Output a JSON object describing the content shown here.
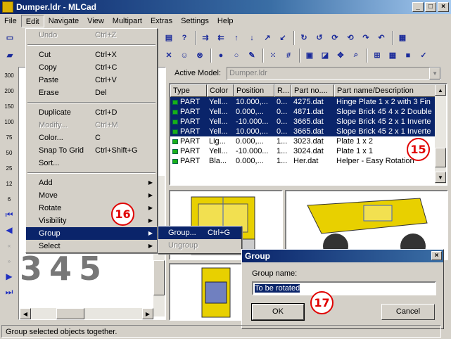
{
  "window": {
    "title": "Dumper.ldr - MLCad",
    "minimize": "_",
    "maximize": "□",
    "close": "×"
  },
  "menubar": [
    "File",
    "Edit",
    "Navigate",
    "View",
    "Multipart",
    "Extras",
    "Settings",
    "Help"
  ],
  "edit_menu": {
    "items": [
      {
        "label": "Undo",
        "shortcut": "Ctrl+Z",
        "disabled": true
      },
      {
        "sep": true
      },
      {
        "label": "Cut",
        "shortcut": "Ctrl+X"
      },
      {
        "label": "Copy",
        "shortcut": "Ctrl+C"
      },
      {
        "label": "Paste",
        "shortcut": "Ctrl+V"
      },
      {
        "label": "Erase",
        "shortcut": "Del"
      },
      {
        "sep": true
      },
      {
        "label": "Duplicate",
        "shortcut": "Ctrl+D"
      },
      {
        "label": "Modify...",
        "shortcut": "Ctrl+M",
        "disabled": true
      },
      {
        "label": "Color...",
        "shortcut": "C"
      },
      {
        "label": "Snap To Grid",
        "shortcut": "Ctrl+Shift+G"
      },
      {
        "label": "Sort..."
      },
      {
        "sep": true
      },
      {
        "label": "Add",
        "submenu": true
      },
      {
        "label": "Move",
        "submenu": true
      },
      {
        "label": "Rotate",
        "submenu": true
      },
      {
        "label": "Visibility",
        "submenu": true
      },
      {
        "label": "Group",
        "submenu": true,
        "highlighted": true
      },
      {
        "label": "Select",
        "submenu": true
      }
    ]
  },
  "group_submenu": [
    {
      "label": "Group...",
      "shortcut": "Ctrl+G",
      "highlighted": true
    },
    {
      "label": "Ungroup",
      "disabled": true
    }
  ],
  "active_model": {
    "label": "Active Model:",
    "value": "Dumper.ldr"
  },
  "parts_table": {
    "columns": [
      "Type",
      "Color",
      "Position",
      "R...",
      "Part no....",
      "Part name/Description"
    ],
    "rows": [
      {
        "type": "PART",
        "color": "Yell...",
        "position": "10.000,...",
        "r": "0...",
        "partno": "4275.dat",
        "desc": "Hinge Plate  1 x 2 with 3 Fin",
        "selected": true
      },
      {
        "type": "PART",
        "color": "Yell...",
        "position": "0.000,...",
        "r": "0...",
        "partno": "4871.dat",
        "desc": "Slope Brick 45  4 x 2 Double",
        "selected": true
      },
      {
        "type": "PART",
        "color": "Yell...",
        "position": "-10.000...",
        "r": "0...",
        "partno": "3665.dat",
        "desc": "Slope Brick 45  2 x 1 Inverte",
        "selected": true
      },
      {
        "type": "PART",
        "color": "Yell...",
        "position": "10.000,...",
        "r": "0...",
        "partno": "3665.dat",
        "desc": "Slope Brick 45  2 x 1 Inverte",
        "selected": true
      },
      {
        "type": "PART",
        "color": "Lig...",
        "position": "0.000,...",
        "r": "1...",
        "partno": "3023.dat",
        "desc": "Plate  1 x  2",
        "selected": false
      },
      {
        "type": "PART",
        "color": "Yell...",
        "position": "-10.000...",
        "r": "1...",
        "partno": "3024.dat",
        "desc": "Plate  1 x  1",
        "selected": false
      },
      {
        "type": "PART",
        "color": "Bla...",
        "position": "0.000,...",
        "r": "1...",
        "partno": "Her.dat",
        "desc": "Helper - Easy Rotation",
        "selected": false
      }
    ]
  },
  "left_panel_digits": "345",
  "dialog": {
    "title": "Group",
    "close": "×",
    "name_label": "Group name:",
    "name_value": "To be rotated",
    "ok": "OK",
    "cancel": "Cancel"
  },
  "callouts": [
    "15",
    "16",
    "17"
  ],
  "left_strip_labels": [
    "300",
    "200",
    "150",
    "100",
    "75",
    "50",
    "25",
    "12",
    "6"
  ],
  "status": "Group selected objects together.",
  "colors": {
    "selection": "#0a246a",
    "callout": "#e00000",
    "face": "#d4d0c8",
    "part_icon": "#18b018"
  }
}
